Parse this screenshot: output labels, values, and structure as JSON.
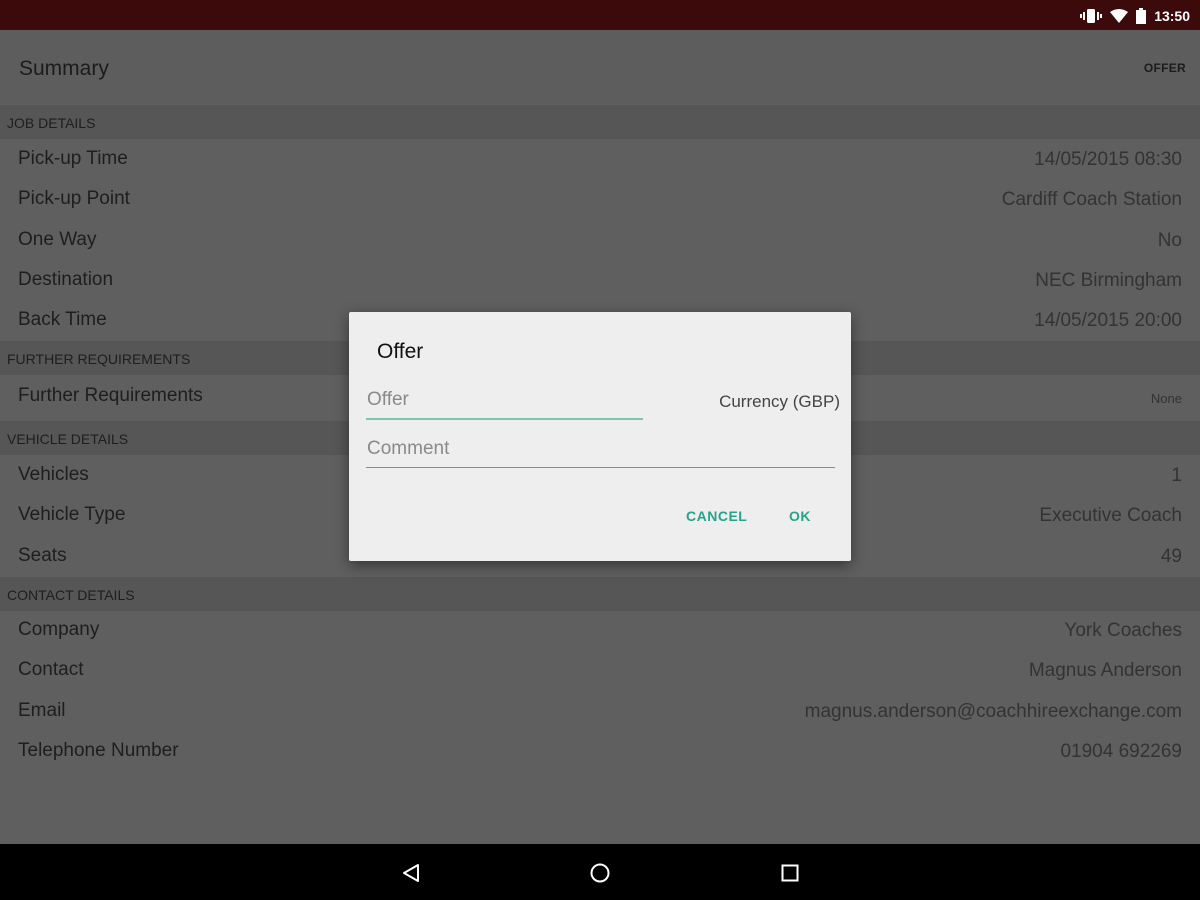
{
  "status_bar": {
    "time": "13:50",
    "icons": [
      "vibrate-icon",
      "wifi-icon",
      "battery-icon"
    ]
  },
  "toolbar": {
    "title": "Summary",
    "action_label": "OFFER"
  },
  "sections": {
    "job": {
      "header": "JOB DETAILS",
      "rows": [
        {
          "label": "Pick-up Time",
          "value": "14/05/2015 08:30"
        },
        {
          "label": "Pick-up Point",
          "value": "Cardiff Coach Station"
        },
        {
          "label": "One Way",
          "value": "No"
        },
        {
          "label": "Destination",
          "value": "NEC Birmingham"
        },
        {
          "label": "Back Time",
          "value": "14/05/2015 20:00"
        }
      ]
    },
    "further": {
      "header": "FURTHER REQUIREMENTS",
      "rows": [
        {
          "label": "Further Requirements",
          "value": "None"
        }
      ]
    },
    "vehicle": {
      "header": "VEHICLE DETAILS",
      "rows": [
        {
          "label": "Vehicles",
          "value": "1"
        },
        {
          "label": "Vehicle Type",
          "value": "Executive Coach"
        },
        {
          "label": "Seats",
          "value": "49"
        }
      ]
    },
    "contact": {
      "header": "CONTACT DETAILS",
      "rows": [
        {
          "label": "Company",
          "value": "York Coaches"
        },
        {
          "label": "Contact",
          "value": "Magnus Anderson"
        },
        {
          "label": "Email",
          "value": "magnus.anderson@coachhireexchange.com"
        },
        {
          "label": "Telephone Number",
          "value": "01904 692269"
        }
      ]
    }
  },
  "dialog": {
    "title": "Offer",
    "offer_placeholder": "Offer",
    "offer_value": "",
    "currency_label": "Currency (GBP)",
    "comment_placeholder": "Comment",
    "comment_value": "",
    "cancel_label": "CANCEL",
    "ok_label": "OK"
  },
  "colors": {
    "status_bar": "#3d0a0c",
    "accent": "#26a38a",
    "dialog_bg": "#eeeeee",
    "scrim_background": "#5f5f5f"
  },
  "nav_bar": {
    "icons": [
      "back-icon",
      "home-icon",
      "recents-icon"
    ]
  }
}
